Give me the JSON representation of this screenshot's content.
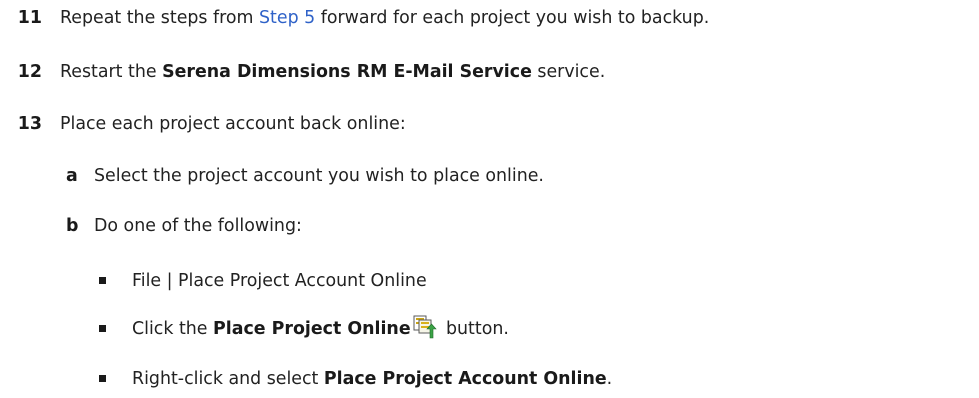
{
  "steps": [
    {
      "number": "11",
      "text_before": "Repeat the steps from ",
      "link": "Step 5",
      "text_after": " forward for each project you wish to backup."
    },
    {
      "number": "12",
      "text_before": "Restart the ",
      "bold": "Serena Dimensions RM E-Mail Service",
      "text_after": " service."
    },
    {
      "number": "13",
      "text": "Place each project account back online:",
      "substeps": [
        {
          "letter": "a",
          "text": "Select the project account you wish to place online."
        },
        {
          "letter": "b",
          "text": "Do one of the following:",
          "bullets": [
            {
              "text": "File | Place Project Account Online"
            },
            {
              "text_before": "Click the ",
              "bold": "Place Project Online",
              "text_after": " button.",
              "icon": "place-project-online-icon"
            },
            {
              "text_before": "Right-click and select ",
              "bold": "Place Project Account Online",
              "text_after": "."
            }
          ]
        }
      ]
    }
  ],
  "colors": {
    "text": "#222222",
    "link": "#2f62c8",
    "icon_green": "#3aa346",
    "icon_yellow": "#d8b11c"
  }
}
